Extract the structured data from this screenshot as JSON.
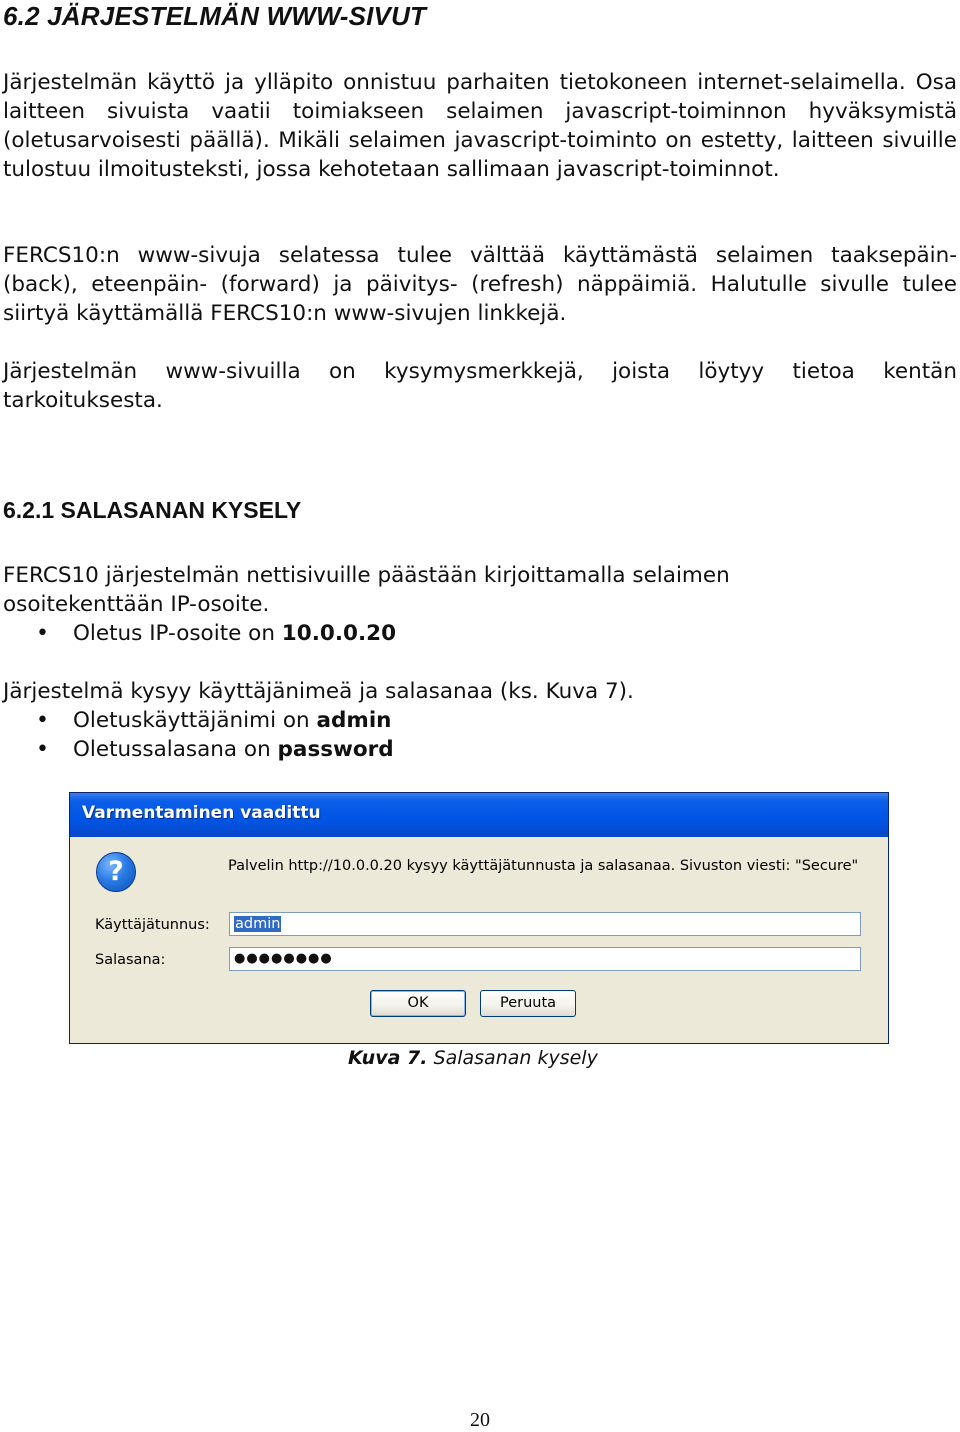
{
  "section": {
    "heading": "6.2 JÄRJESTELMÄN WWW-SIVUT",
    "paragraph1": "Järjestelmän käyttö ja ylläpito onnistuu parhaiten tietokoneen internet-selaimella. Osa laitteen sivuista vaatii toimiakseen selaimen javascript-toiminnon hyväksymistä (oletusarvoisesti päällä). Mikäli selaimen javascript-toiminto on estetty, laitteen sivuille tulostuu ilmoitusteksti, jossa kehotetaan sallimaan javascript-toiminnot.",
    "paragraph2": "FERCS10:n www-sivuja selatessa tulee välttää käyttämästä selaimen taaksepäin- (back), eteenpäin- (forward) ja päivitys- (refresh) näppäimiä. Halutulle sivulle tulee siirtyä käyttämällä FERCS10:n www-sivujen linkkejä.",
    "paragraph3": "Järjestelmän www-sivuilla on kysymysmerkkejä, joista löytyy tietoa kentän tarkoituksesta."
  },
  "subsection": {
    "heading": "6.2.1 SALASANAN KYSELY",
    "intro_line1": "FERCS10 järjestelmän nettisivuille päästään kirjoittamalla selaimen",
    "intro_line2": "osoitekenttään IP-osoite.",
    "bullet_ip_prefix": "Oletus IP-osoite on ",
    "bullet_ip_value": "10.0.0.20",
    "login_line": "Järjestelmä kysyy käyttäjänimeä ja salasanaa (ks. Kuva 7).",
    "bullet_user_prefix": "Oletuskäyttäjänimi on ",
    "bullet_user_value": "admin",
    "bullet_pass_prefix": "Oletussalasana on ",
    "bullet_pass_value": "password",
    "bullet_symbol": "•"
  },
  "dialog": {
    "title": "Varmentaminen vaadittu",
    "message": "Palvelin http://10.0.0.20 kysyy käyttäjätunnusta ja salasanaa. Sivuston viesti: \"Secure\"",
    "username_label": "Käyttäjätunnus:",
    "username_value": "admin",
    "password_label": "Salasana:",
    "password_value": "●●●●●●●●",
    "ok_label": "OK",
    "cancel_label": "Peruuta",
    "question_icon_glyph": "?"
  },
  "figure": {
    "caption_label": "Kuva 7.",
    "caption_text": " Salasanan kysely"
  },
  "page_number": "20",
  "colors": {
    "title_bar": "#0055e5",
    "dialog_bg": "#ece9d8",
    "selection": "#316ac5"
  }
}
